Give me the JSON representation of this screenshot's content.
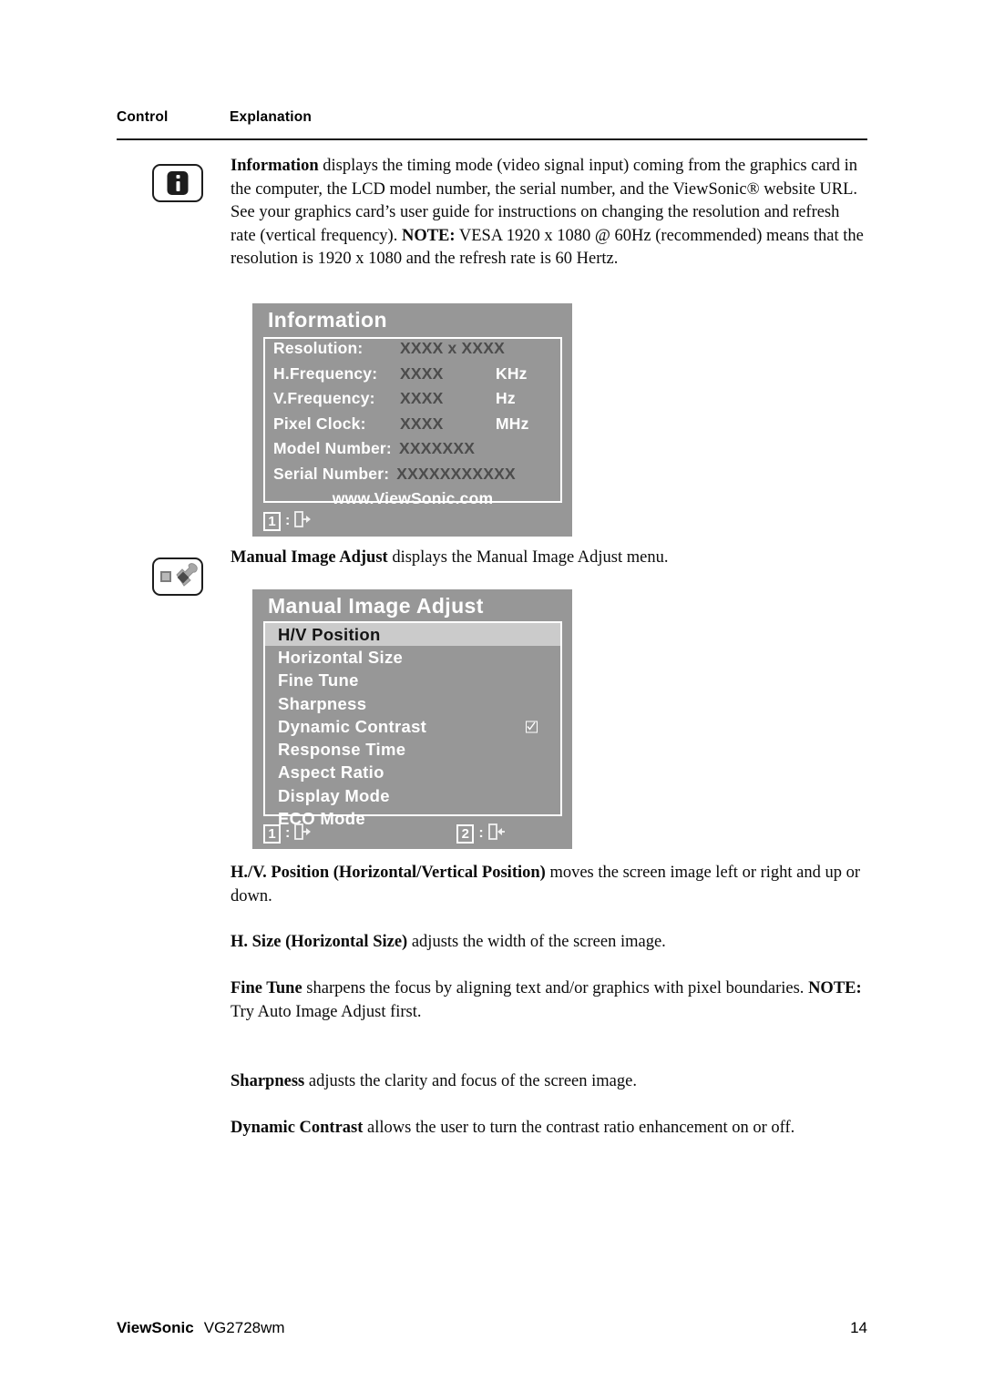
{
  "table_headers": {
    "control": "Control",
    "explanation": "Explanation"
  },
  "icons": {
    "information": "information-icon",
    "manual_image_adjust": "wrench-icon"
  },
  "paragraphs": {
    "information": {
      "term": "Information",
      "rest": " displays the timing mode (video signal input) coming from the graphics card in the computer, the LCD model number, the serial number, and the ViewSonic® website URL. See your graphics card’s user guide for instructions on changing the resolution and refresh rate (vertical frequency).",
      "note_label": "NOTE:",
      "note_rest": " VESA 1920 x 1080 @ 60Hz (recommended) means that the resolution is 1920 x 1080 and the refresh rate is 60 Hertz."
    },
    "manual_image_adjust": {
      "term": "Manual Image Adjust",
      "rest": " displays the Manual Image Adjust menu."
    },
    "hv_position": {
      "term": "H./V. Position (Horizontal/Vertical Position)",
      "rest": " moves the screen image left or right and up or down."
    },
    "h_size": {
      "term": "H. Size (Horizontal Size)",
      "rest": " adjusts the width of the screen image."
    },
    "fine_tune": {
      "term": "Fine Tune",
      "rest": " sharpens the focus by aligning text and/or graphics with pixel boundaries.",
      "note_label": "NOTE:",
      "note_rest": " Try Auto Image Adjust first."
    },
    "sharpness": {
      "term": "Sharpness",
      "rest": " adjusts the clarity and focus of the screen image."
    },
    "dynamic_contrast": {
      "term": "Dynamic Contrast",
      "rest": " allows the user to turn the contrast ratio enhancement on or off."
    }
  },
  "osd_information": {
    "title": "Information",
    "rows": [
      {
        "label": "Resolution:",
        "value": "XXXX x XXXX",
        "unit": ""
      },
      {
        "label": "H.Frequency:",
        "value": "XXXX",
        "unit": "KHz"
      },
      {
        "label": "V.Frequency:",
        "value": "XXXX",
        "unit": "Hz"
      },
      {
        "label": "Pixel Clock:",
        "value": "XXXX",
        "unit": "MHz"
      }
    ],
    "model_number": {
      "label": "Model Number:",
      "value": "XXXXXXX"
    },
    "serial_number": {
      "label": "Serial Number:",
      "value": "XXXXXXXXXXX"
    },
    "website": "www.ViewSonic.com",
    "hints": [
      {
        "key": "1",
        "colon": ":",
        "icon": "exit-icon"
      }
    ]
  },
  "osd_manual_image_adjust": {
    "title": "Manual Image Adjust",
    "items": [
      {
        "label": "H/V Position",
        "selected": true,
        "checkbox": false
      },
      {
        "label": "Horizontal Size",
        "selected": false,
        "checkbox": false
      },
      {
        "label": "Fine Tune",
        "selected": false,
        "checkbox": false
      },
      {
        "label": "Sharpness",
        "selected": false,
        "checkbox": false
      },
      {
        "label": "Dynamic Contrast",
        "selected": false,
        "checkbox": true
      },
      {
        "label": "Response Time",
        "selected": false,
        "checkbox": false
      },
      {
        "label": "Aspect Ratio",
        "selected": false,
        "checkbox": false
      },
      {
        "label": "Display Mode",
        "selected": false,
        "checkbox": false
      },
      {
        "label": "ECO Mode",
        "selected": false,
        "checkbox": false
      }
    ],
    "hints": [
      {
        "key": "1",
        "colon": ":",
        "icon": "exit-icon"
      },
      {
        "key": "2",
        "colon": ":",
        "icon": "return-icon"
      }
    ]
  },
  "footer": {
    "brand": "ViewSonic",
    "model": "VG2728wm",
    "page_number": "14"
  },
  "colors": {
    "osd_background": "#979797",
    "osd_highlight": "#cbcbcb",
    "osd_text": "#ffffff",
    "osd_value_text": "#4c4c4c",
    "page_text": "#0b0b0b"
  }
}
